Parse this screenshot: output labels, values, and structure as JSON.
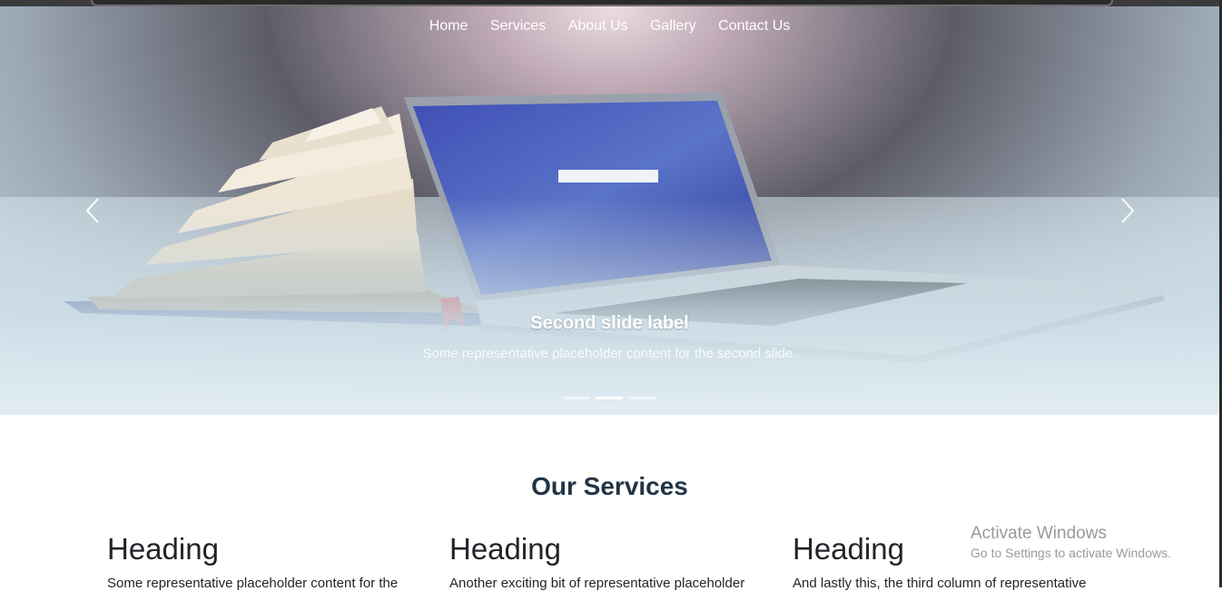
{
  "nav": {
    "items": [
      {
        "label": "Home"
      },
      {
        "label": "Services"
      },
      {
        "label": "About Us"
      },
      {
        "label": "Gallery"
      },
      {
        "label": "Contact Us"
      }
    ]
  },
  "carousel": {
    "active_index": 1,
    "slide_count": 3,
    "caption_title": "Second slide label",
    "caption_text": "Some representative placeholder content for the second slide.",
    "prev_icon": "chevron-left-icon",
    "next_icon": "chevron-right-icon"
  },
  "services": {
    "title": "Our Services",
    "columns": [
      {
        "heading": "Heading",
        "text": "Some representative placeholder content for the"
      },
      {
        "heading": "Heading",
        "text": "Another exciting bit of representative placeholder"
      },
      {
        "heading": "Heading",
        "text": "And lastly this, the third column of representative"
      }
    ]
  },
  "watermark": {
    "line1": "Activate Windows",
    "line2": "Go to Settings to activate Windows."
  },
  "colors": {
    "heading": "#223445",
    "text": "#212529",
    "watermark": "#9a9a9a"
  }
}
